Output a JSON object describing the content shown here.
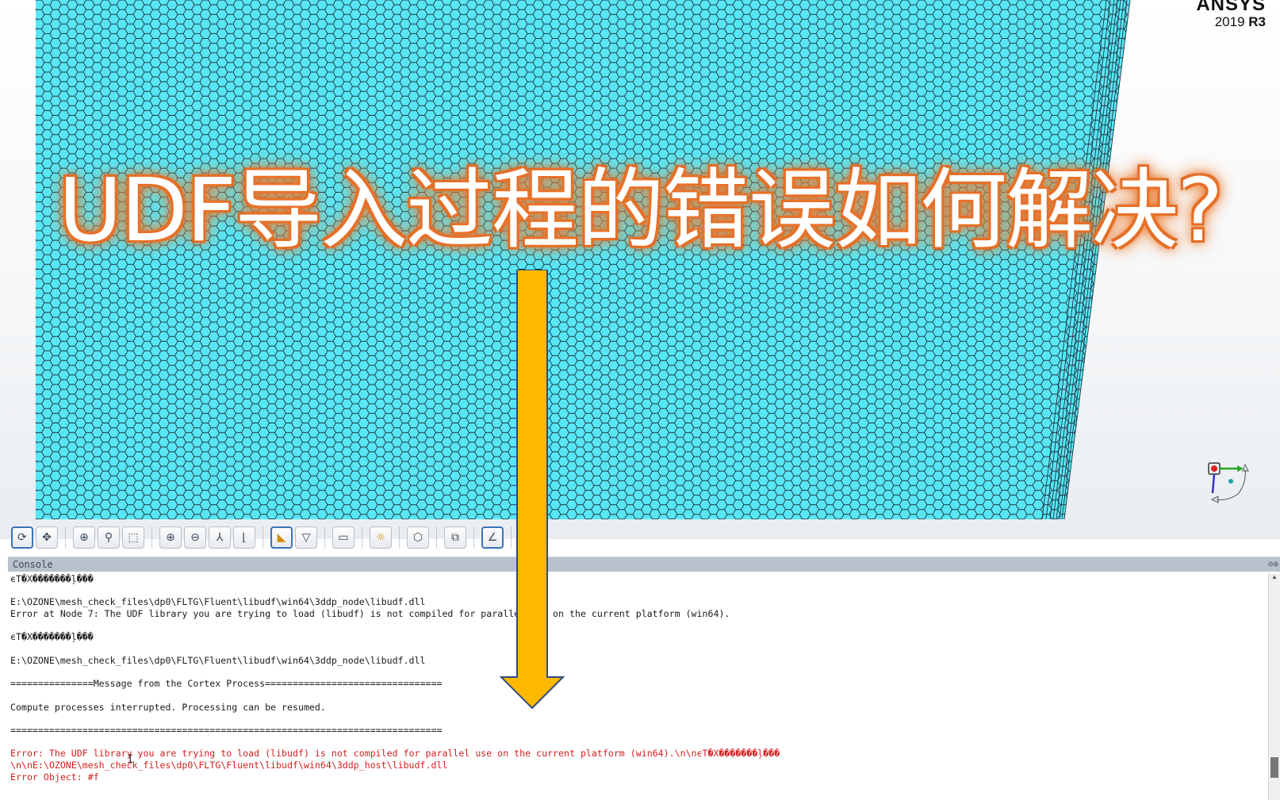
{
  "logo": {
    "brand": "ANSYS",
    "version": "2019",
    "release": "R3"
  },
  "overlay": {
    "title": "UDF导入过程的错误如何解决?"
  },
  "toolbar": {
    "buttons": [
      {
        "name": "rotate-icon",
        "glyph": "⟳"
      },
      {
        "name": "pan-icon",
        "glyph": "✥"
      },
      {
        "name": "zoom-dynamic-icon",
        "glyph": "⊕"
      },
      {
        "name": "zoom-icon",
        "glyph": "⚲"
      },
      {
        "name": "zoom-box-icon",
        "glyph": "⬚"
      },
      {
        "name": "zoom-in-icon",
        "glyph": "⊕"
      },
      {
        "name": "zoom-out-icon",
        "glyph": "⊖"
      },
      {
        "name": "axes-icon",
        "glyph": "⅄"
      },
      {
        "name": "fit-icon",
        "glyph": "⌊"
      },
      {
        "name": "select-icon",
        "glyph": "◣"
      },
      {
        "name": "mesh-display-icon",
        "glyph": "▽"
      },
      {
        "name": "clip-icon",
        "glyph": "▭"
      },
      {
        "name": "light-icon",
        "glyph": "☼"
      },
      {
        "name": "iso-view-icon",
        "glyph": "⬡"
      },
      {
        "name": "view-icon",
        "glyph": "⧉"
      },
      {
        "name": "ruler-icon",
        "glyph": "∠"
      },
      {
        "name": "notes-icon",
        "glyph": "▤"
      }
    ]
  },
  "console": {
    "title": "Console",
    "header_icons": "⊘⊗",
    "lines": [
      {
        "text": "ϵT�X�������ļ���",
        "type": "normal"
      },
      {
        "text": "",
        "type": "normal"
      },
      {
        "text": "E:\\OZONE\\mesh_check_files\\dp0\\FLTG\\Fluent\\libudf\\win64\\3ddp_node\\libudf.dll",
        "type": "normal"
      },
      {
        "text": "Error at Node 7: The UDF library you are trying to load (libudf) is not compiled for parallel use on the current platform (win64).",
        "type": "normal"
      },
      {
        "text": "",
        "type": "normal"
      },
      {
        "text": "ϵT�X�������ļ���",
        "type": "normal"
      },
      {
        "text": "",
        "type": "normal"
      },
      {
        "text": "E:\\OZONE\\mesh_check_files\\dp0\\FLTG\\Fluent\\libudf\\win64\\3ddp_node\\libudf.dll",
        "type": "normal"
      },
      {
        "text": "",
        "type": "normal"
      },
      {
        "text": "===============Message from the Cortex Process================================",
        "type": "normal"
      },
      {
        "text": "",
        "type": "normal"
      },
      {
        "text": "Compute processes interrupted. Processing can be resumed.",
        "type": "normal"
      },
      {
        "text": "",
        "type": "normal"
      },
      {
        "text": "==============================================================================",
        "type": "normal"
      },
      {
        "text": "",
        "type": "normal"
      },
      {
        "text": "Error: The UDF library you are trying to load (libudf) is not compiled for parallel use on the current platform (win64).\\n\\nϵT�X�������ļ���",
        "type": "red"
      },
      {
        "text": "\\n\\nE:\\OZONE\\mesh_check_files\\dp0\\FLTG\\Fluent\\libudf\\win64\\3ddp_host\\libudf.dll",
        "type": "red"
      },
      {
        "text": "Error Object: #f",
        "type": "red"
      }
    ]
  },
  "colors": {
    "mesh_fill": "#58e6f5",
    "mesh_line": "#1f3440",
    "arrow_fill": "#ffb800",
    "arrow_stroke": "#2e4a7a",
    "error_text": "#d21f1f"
  }
}
